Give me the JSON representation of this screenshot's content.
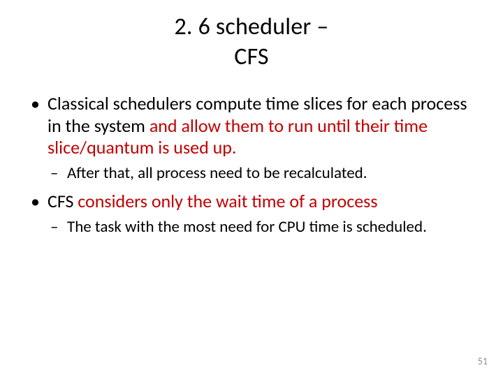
{
  "title": {
    "line1": "2. 6 scheduler –",
    "line2": "CFS"
  },
  "bullets": [
    {
      "pre": "Classical schedulers compute time slices for each process in the system ",
      "accent": "and allow them to run until their time slice/quantum is used up.",
      "sub": [
        "After that, all process need to be recalculated."
      ]
    },
    {
      "pre": "CFS ",
      "accent": "considers only the wait time of a process",
      "sub": [
        "The task with the most need for CPU time is scheduled."
      ]
    }
  ],
  "pageNumber": "51"
}
